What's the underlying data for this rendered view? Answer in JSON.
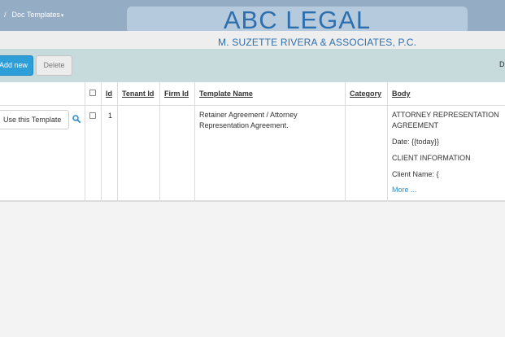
{
  "breadcrumb": {
    "separator": "/",
    "current": "Doc Templates",
    "caret": "▾"
  },
  "brand": {
    "title": "ABC LEGAL",
    "subtitle": "M. SUZETTE RIVERA & ASSOCIATES, P.C."
  },
  "toolbar": {
    "add_label": "Add new",
    "delete_label": "Delete",
    "right_text": "D"
  },
  "table": {
    "headers": {
      "id": "Id",
      "tenant_id": "Tenant Id",
      "firm_id": "Firm Id",
      "template_name": "Template Name",
      "category": "Category",
      "body": "Body"
    },
    "rows": [
      {
        "action_label": "Use this Template",
        "id": "1",
        "tenant_id": "",
        "firm_id": "",
        "template_name_line1": "Retainer Agreement / Attorney",
        "template_name_line2": "Representation Agreement.",
        "category": "",
        "body_line1": "ATTORNEY REPRESENTATION",
        "body_line2": "AGREEMENT",
        "body_line3": "Date: {{today}}",
        "body_line4": "CLIENT INFORMATION",
        "body_line5": "Client Name: {",
        "more_label": "More ..."
      }
    ]
  },
  "icons": {
    "search": "search-icon",
    "checkbox": "checkbox-icon",
    "caret": "chevron-down-icon"
  },
  "colors": {
    "topbar": "#94adc5",
    "brand_text": "#2d6fae",
    "toolbar": "#c7dbdc",
    "primary_button": "#2e9ed9",
    "link": "#2e8ed0"
  }
}
